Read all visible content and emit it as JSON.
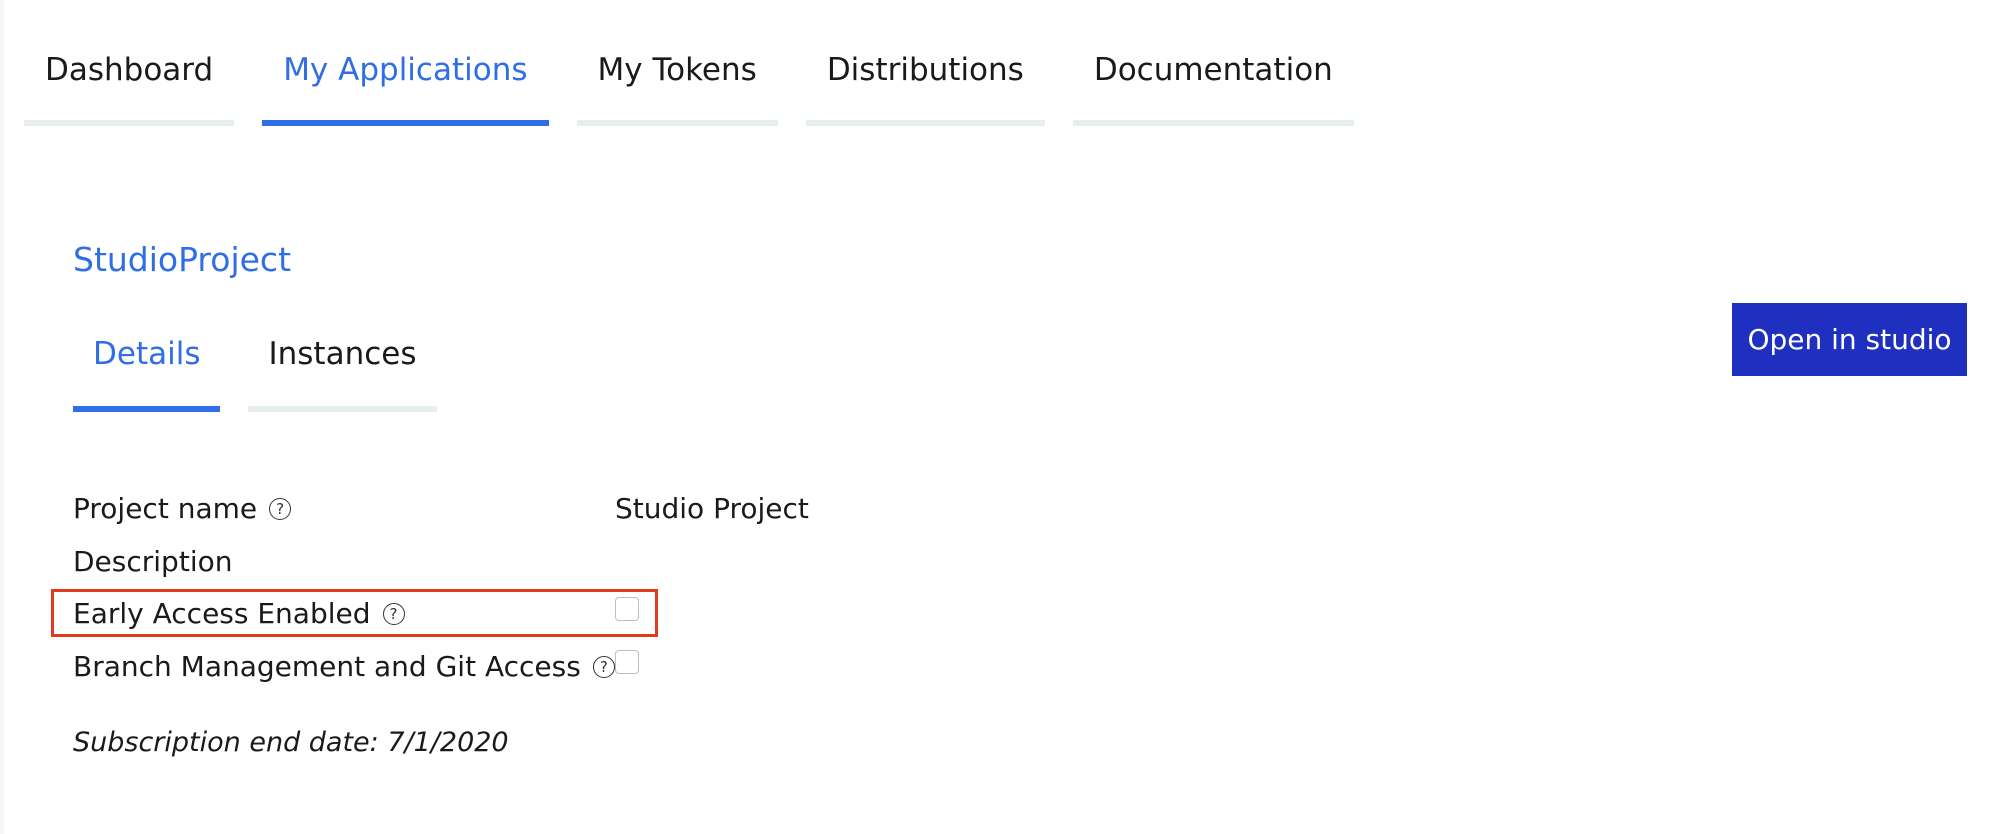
{
  "nav": {
    "tabs": [
      {
        "label": "Dashboard",
        "active": false
      },
      {
        "label": "My Applications",
        "active": true
      },
      {
        "label": "My Tokens",
        "active": false
      },
      {
        "label": "Distributions",
        "active": false
      },
      {
        "label": "Documentation",
        "active": false
      }
    ]
  },
  "project": {
    "title": "StudioProject",
    "open_button_label": "Open in studio",
    "tabs": [
      {
        "label": "Details",
        "active": true
      },
      {
        "label": "Instances",
        "active": false
      }
    ]
  },
  "details": {
    "project_name": {
      "label": "Project name",
      "value": "Studio Project"
    },
    "description": {
      "label": "Description"
    },
    "early_access": {
      "label": "Early Access Enabled",
      "checked": false
    },
    "branch_management": {
      "label": "Branch Management and Git Access",
      "checked": false
    },
    "help_glyph": "?",
    "subscription": "Subscription end date: 7/1/2020"
  },
  "colors": {
    "accent": "#2f6ee6",
    "button": "#1f2fbf",
    "highlight": "#e03c1e",
    "tab_underline": "#e7eeef"
  }
}
